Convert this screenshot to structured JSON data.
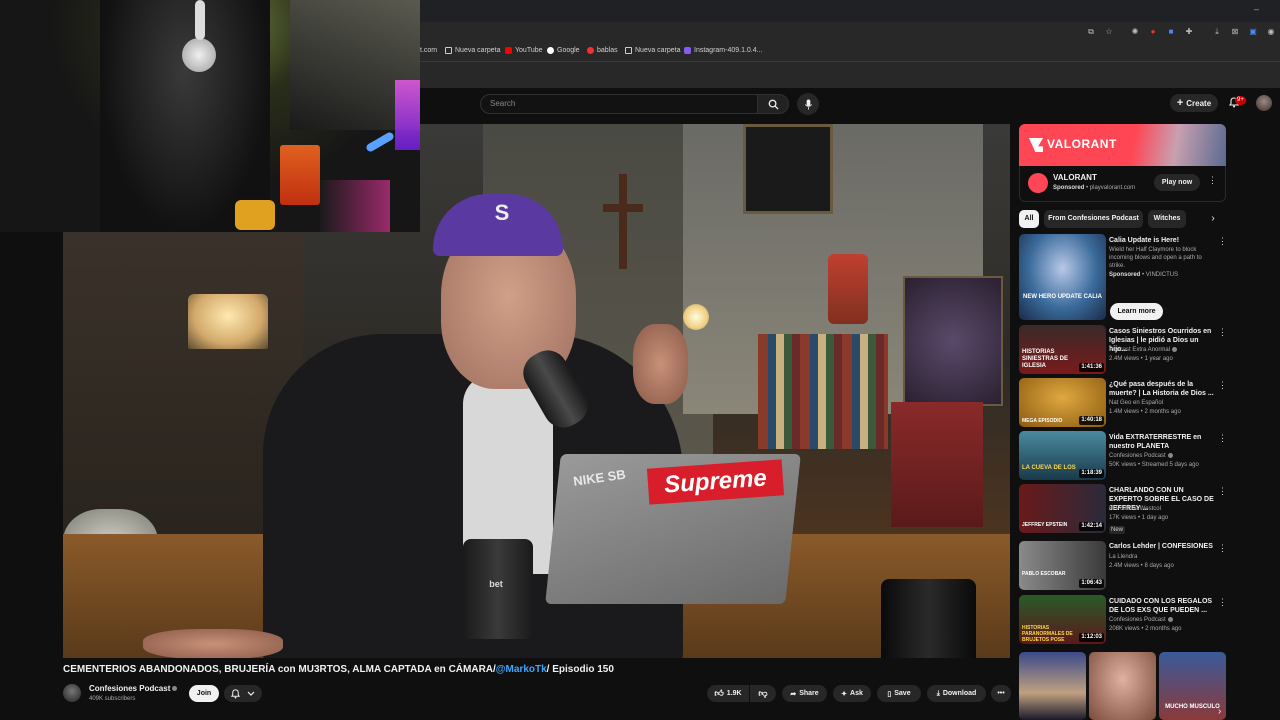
{
  "colors": {
    "background": "#0f0f0f",
    "accent_red": "#cc0000",
    "link_blue": "#3ea6ff",
    "valorant_red": "#ff4655"
  },
  "bookmarks": [
    {
      "label": "t.com",
      "icon": "globe-icon"
    },
    {
      "label": "Nueva carpeta",
      "icon": "folder-icon"
    },
    {
      "label": "YouTube",
      "icon": "youtube-icon"
    },
    {
      "label": "Google",
      "icon": "google-icon"
    },
    {
      "label": "bablas",
      "icon": "bookmark-icon"
    },
    {
      "label": "Nueva carpeta",
      "icon": "folder-icon"
    },
    {
      "label": "Instagram-409.1.0.4...",
      "icon": "instagram-icon"
    }
  ],
  "header": {
    "search_placeholder": "Search",
    "create_label": "Create",
    "notifications_badge": "9+"
  },
  "video": {
    "title_main": "CEMENTERIOS ABANDONADOS, BRUJERÍA con MU3RTOS, ALMA CAPTADA en CÁMARA/",
    "title_mention": "@MarkoTk",
    "title_end": "/ Episodio 150",
    "channel_name": "Confesiones Podcast",
    "subscribers": "409K subscribers",
    "join_label": "Join",
    "likes": "1.9K",
    "share_label": "Share",
    "ask_label": "Ask",
    "save_label": "Save",
    "download_label": "Download",
    "scene": {
      "cap_letter": "S",
      "laptop_sticker": "Supreme",
      "laptop_brand": "NIKE SB",
      "cup_label": "bet"
    }
  },
  "ad": {
    "banner_brand": "VALORANT",
    "name": "VALORANT",
    "sponsored": "Sponsored",
    "domain": "playvalorant.com",
    "cta": "Play now"
  },
  "chips": [
    "All",
    "From Confesiones Podcast",
    "Witches"
  ],
  "recommendations": [
    {
      "title": "Calia Update is Here!",
      "description": "Wield her Half Claymore to block incoming blows and open a path to strike.",
      "sponsored_line": "Sponsored",
      "advertiser": "VINDICTUS",
      "cta": "Learn more",
      "thumb_text": "NEW HERO UPDATE CALIA",
      "accent": "#3a6a9a"
    },
    {
      "title": "Casos Siniestros Ocurridos en Iglesias | le pidió a Dios un hijo...",
      "channel": "Podcast Extra Anormal",
      "meta": "2.4M views • 1 year ago",
      "duration": "1:41:36",
      "thumb_text": "HISTORIAS SINIESTRAS DE IGLESIA",
      "accent": "#7a1a1a"
    },
    {
      "title": "¿Qué pasa después de la muerte? | La Historia de Dios ...",
      "channel": "Nat Geo en Español",
      "meta": "1.4M views • 2 months ago",
      "duration": "1:40:18",
      "thumb_text": "MEGA EPISODIO",
      "accent": "#b8861a"
    },
    {
      "title": "Vida EXTRATERRESTRE en nuestro PLANETA",
      "channel": "Confesiones Podcast",
      "meta": "50K views • Streamed 5 days ago",
      "duration": "1:18:39",
      "thumb_text": "LA CUEVA DE LOS",
      "accent": "#2a5a6a"
    },
    {
      "title": "CHARLANDO CON UN EXPERTO SOBRE EL CASO DE JEFFREY ...",
      "channel": "El Point de Westcol",
      "meta": "17K views • 1 day ago",
      "badge": "New",
      "duration": "1:42:14",
      "thumb_text": "JEFFREY EPSTEIN",
      "accent": "#8a1a1a"
    },
    {
      "title": "Carlos Lehder | CONFESIONES",
      "channel": "La Llendra",
      "meta": "2.4M views • 8 days ago",
      "duration": "1:06:43",
      "thumb_text": "PABLO ESCOBAR",
      "accent": "#5a5a5a"
    },
    {
      "title": "CUIDADO CON LOS REGALOS DE LOS EXS QUE PUEDEN ...",
      "channel": "Confesiones Podcast",
      "meta": "208K views • 2 months ago",
      "duration": "1:12:03",
      "thumb_text": "HISTORIAS PARANORMALES DE BRUJETOS POSE",
      "accent": "#6a1a1a"
    }
  ],
  "shorts": [
    {
      "thumb_text": "",
      "accent": "#2a3a6a"
    },
    {
      "thumb_text": "",
      "accent": "#a05a4a"
    },
    {
      "thumb_text": "MUCHO MUSCULO",
      "accent": "#3a5a9a"
    }
  ]
}
